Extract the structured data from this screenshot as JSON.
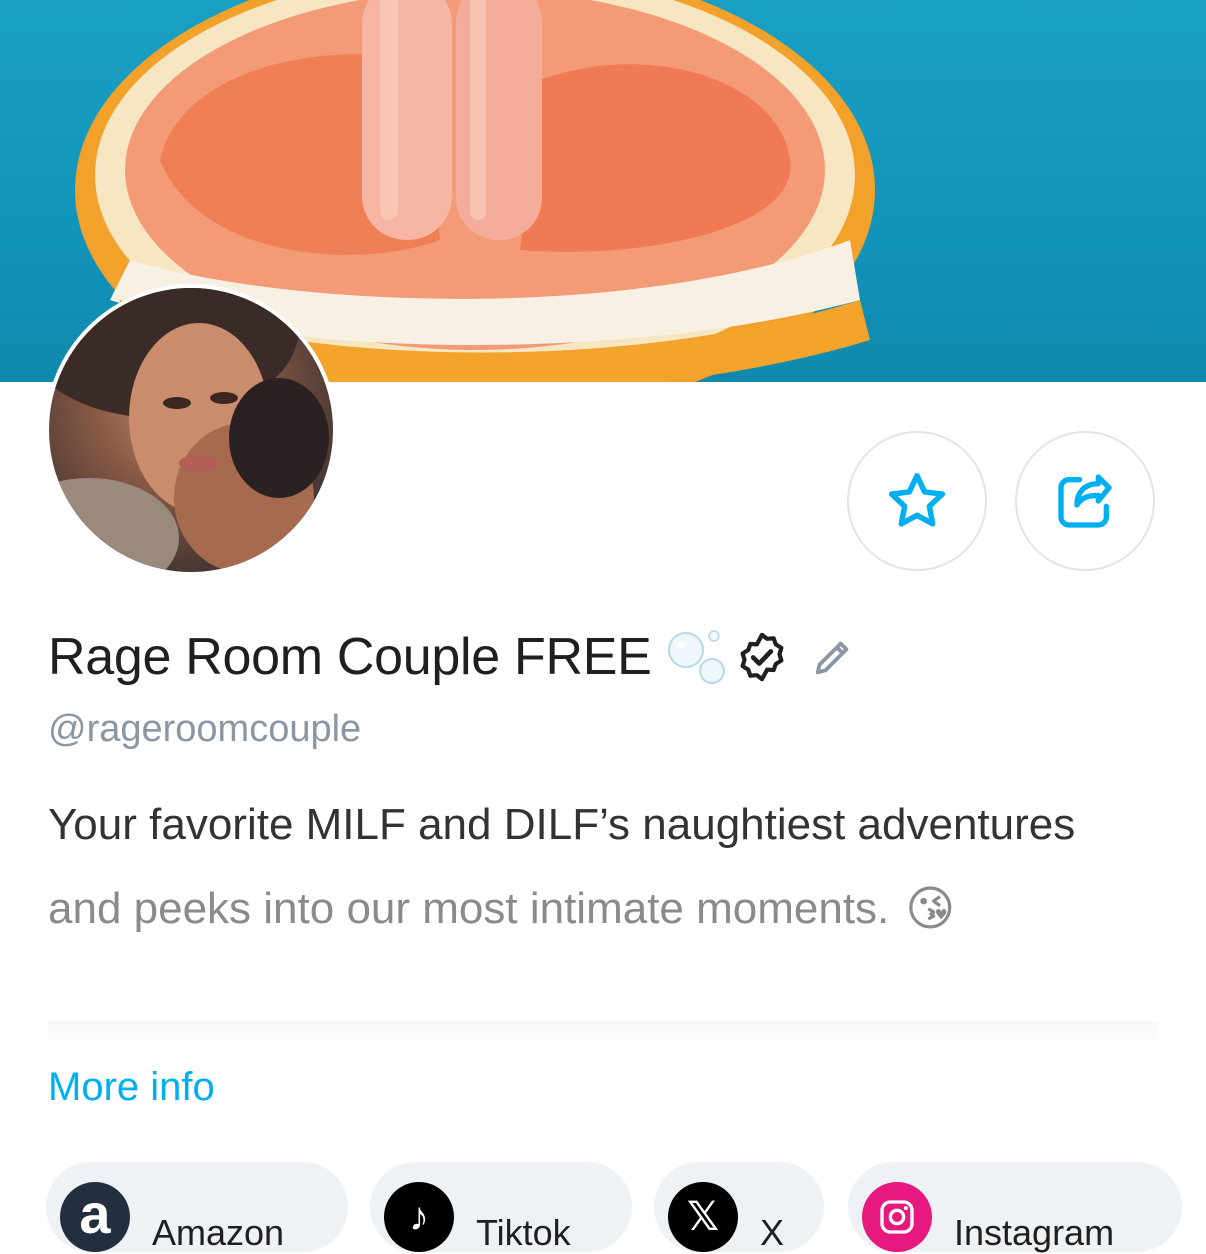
{
  "profile": {
    "display_name": "Rage Room Couple FREE",
    "handle": "@rageroomcouple",
    "bio_line_1": "Your favorite MILF and DILF’s naughtiest adventures",
    "bio_line_2": "and peeks into our most intimate moments.",
    "bio_emoji": "😘",
    "more_info_label": "More info"
  },
  "actions": {
    "favorite": "star-icon",
    "share": "share-icon"
  },
  "social_links": [
    {
      "label": "Amazon",
      "icon": "amazon-icon",
      "color": "#232f3e"
    },
    {
      "label": "Tiktok",
      "icon": "tiktok-icon",
      "color": "#000000"
    },
    {
      "label": "X",
      "icon": "x-icon",
      "color": "#000000"
    },
    {
      "label": "Instagram",
      "icon": "instagram-icon",
      "color": "#e1306c"
    }
  ],
  "colors": {
    "accent": "#00aff0",
    "handle": "#8a96a3",
    "cover_bg": "#1296bb"
  }
}
